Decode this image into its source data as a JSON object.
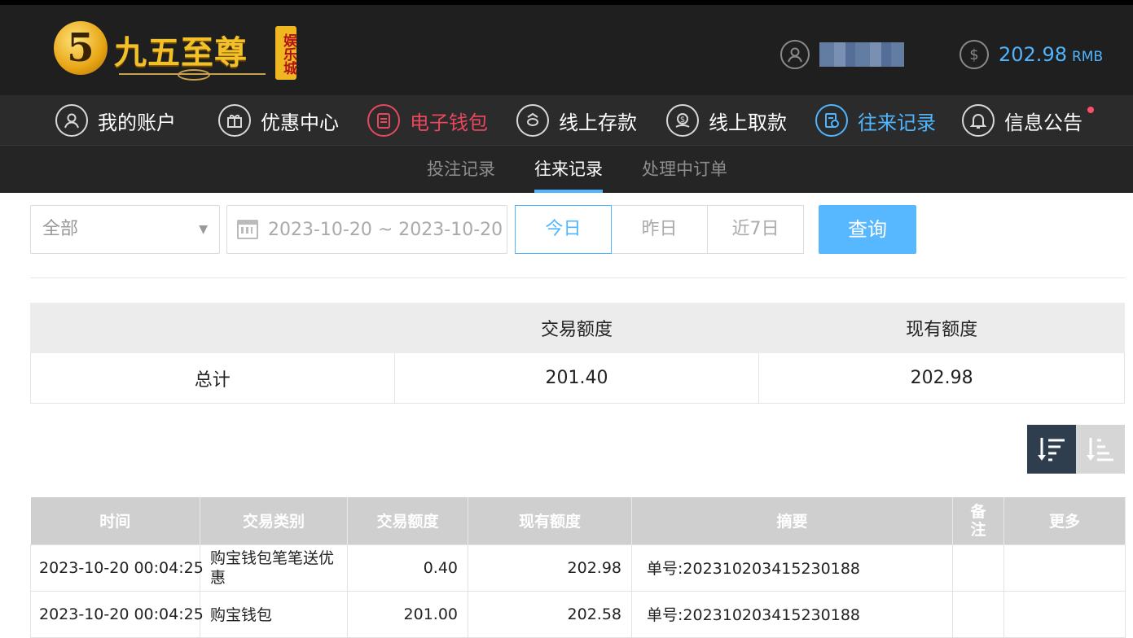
{
  "header": {
    "logo_text": "九五至尊",
    "logo_vert": "娱乐城",
    "balance_amount": "202.98",
    "balance_unit": "RMB"
  },
  "nav": {
    "items": [
      {
        "label": "我的账户",
        "icon": "user-icon"
      },
      {
        "label": "优惠中心",
        "icon": "gift-icon"
      },
      {
        "label": "电子钱包",
        "icon": "wallet-icon"
      },
      {
        "label": "线上存款",
        "icon": "deposit-icon"
      },
      {
        "label": "线上取款",
        "icon": "withdraw-icon"
      },
      {
        "label": "往来记录",
        "icon": "records-icon"
      },
      {
        "label": "信息公告",
        "icon": "bell-icon"
      }
    ]
  },
  "subnav": {
    "tabs": [
      "投注记录",
      "往来记录",
      "处理中订单"
    ]
  },
  "filters": {
    "type_select": "全部",
    "date_range": "2023-10-20 ~ 2023-10-20",
    "range_buttons": [
      "今日",
      "昨日",
      "近7日"
    ],
    "query_label": "查询"
  },
  "summary": {
    "headers": [
      "",
      "交易额度",
      "现有额度"
    ],
    "row_label": "总计",
    "trade_amount": "201.40",
    "current_amount": "202.98"
  },
  "records": {
    "headers": [
      "时间",
      "交易类别",
      "交易额度",
      "现有额度",
      "摘要",
      "备注",
      "更多"
    ],
    "rows": [
      {
        "time": "2023-10-20 00:04:25",
        "type": "购宝钱包笔笔送优惠",
        "amount": "0.40",
        "balance": "202.98",
        "summary": "单号:20231020341523018​8"
      },
      {
        "time": "2023-10-20 00:04:25",
        "type": "购宝钱包",
        "amount": "201.00",
        "balance": "202.58",
        "summary": "单号:202310203415230188"
      }
    ]
  },
  "colors": {
    "accent_blue": "#4fb5ff",
    "accent_red": "#e8475e",
    "header_bg": "#1f1f1f"
  }
}
